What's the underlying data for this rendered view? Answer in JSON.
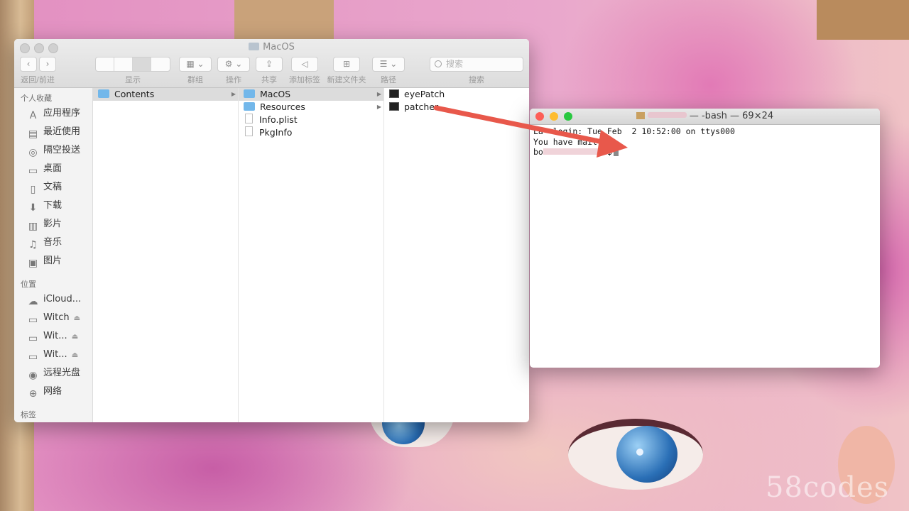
{
  "finder": {
    "title": "MacOS",
    "toolbar": {
      "back_forward_label": "返回/前进",
      "view_label": "显示",
      "group_label": "群组",
      "action_label": "操作",
      "share_label": "共享",
      "tag_label": "添加标签",
      "new_folder_label": "新建文件夹",
      "path_label": "路径",
      "search_label": "搜索",
      "search_placeholder": "搜索"
    },
    "sidebar": {
      "favorites_header": "个人收藏",
      "favorites": [
        {
          "label": "应用程序",
          "icon": "applications-icon"
        },
        {
          "label": "最近使用",
          "icon": "recents-icon"
        },
        {
          "label": "隔空投送",
          "icon": "airdrop-icon"
        },
        {
          "label": "桌面",
          "icon": "desktop-icon"
        },
        {
          "label": "文稿",
          "icon": "documents-icon"
        },
        {
          "label": "下载",
          "icon": "downloads-icon"
        },
        {
          "label": "影片",
          "icon": "movies-icon"
        },
        {
          "label": "音乐",
          "icon": "music-icon"
        },
        {
          "label": "图片",
          "icon": "pictures-icon"
        }
      ],
      "locations_header": "位置",
      "locations": [
        {
          "label": "iCloud...",
          "icon": "icloud-icon"
        },
        {
          "label": "Witch",
          "icon": "disk-icon"
        },
        {
          "label": "Wit...",
          "icon": "disk-icon"
        },
        {
          "label": "Wit...",
          "icon": "disk-icon"
        },
        {
          "label": "远程光盘",
          "icon": "remote-disc-icon"
        },
        {
          "label": "网络",
          "icon": "network-icon"
        }
      ],
      "tags_header": "标签"
    },
    "columns": [
      [
        {
          "name": "Contents",
          "type": "folder",
          "selected": true
        }
      ],
      [
        {
          "name": "MacOS",
          "type": "folder",
          "selected": true
        },
        {
          "name": "Resources",
          "type": "folder"
        },
        {
          "name": "Info.plist",
          "type": "document"
        },
        {
          "name": "PkgInfo",
          "type": "document"
        }
      ],
      [
        {
          "name": "eyePatch",
          "type": "executable"
        },
        {
          "name": "patcher",
          "type": "executable"
        }
      ]
    ]
  },
  "terminal": {
    "title_suffix": "— -bash — 69×24",
    "line1": "La  login: Tue Feb  2 10:52:00 on ttys000",
    "line2": "You have mail.",
    "prompt_start": "bo",
    "prompt_end": "$"
  },
  "watermark": "58codes",
  "colors": {
    "arrow": "#e8584b",
    "folder": "#72b7ea",
    "close": "#fd5f57",
    "minimize": "#febc2e",
    "zoom": "#28c840"
  }
}
